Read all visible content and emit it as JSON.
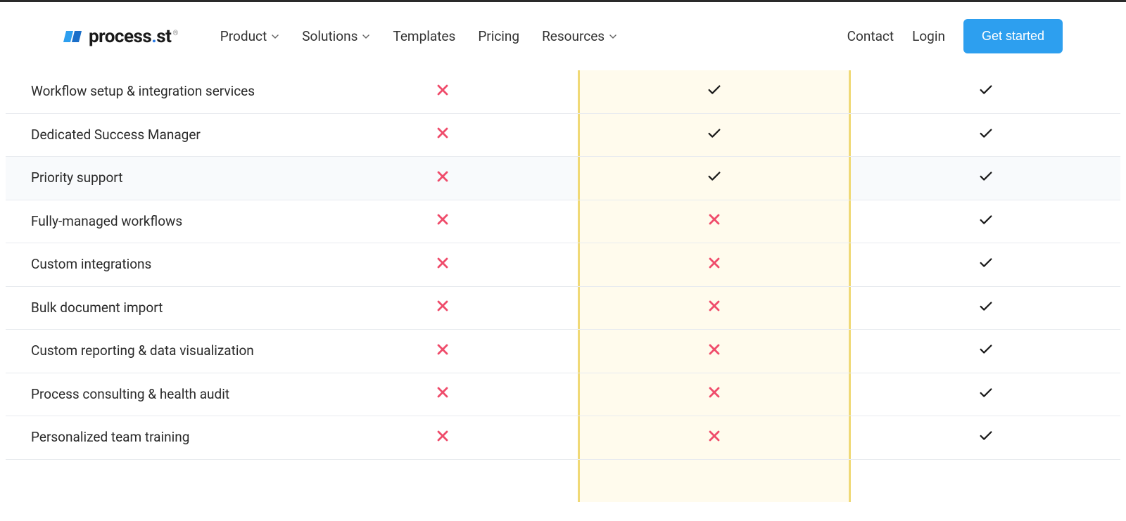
{
  "logo": {
    "text_prefix": "process",
    "text_dot": ".",
    "text_suffix": "st"
  },
  "nav": {
    "product": "Product",
    "solutions": "Solutions",
    "templates": "Templates",
    "pricing": "Pricing",
    "resources": "Resources"
  },
  "header_right": {
    "contact": "Contact",
    "login": "Login",
    "cta": "Get started"
  },
  "features": [
    {
      "label": "Workflow setup & integration services",
      "col1": false,
      "col2": true,
      "col3": true,
      "alt": false
    },
    {
      "label": "Dedicated Success Manager",
      "col1": false,
      "col2": true,
      "col3": true,
      "alt": false
    },
    {
      "label": "Priority support",
      "col1": false,
      "col2": true,
      "col3": true,
      "alt": true
    },
    {
      "label": "Fully-managed workflows",
      "col1": false,
      "col2": false,
      "col3": true,
      "alt": false
    },
    {
      "label": "Custom integrations",
      "col1": false,
      "col2": false,
      "col3": true,
      "alt": false
    },
    {
      "label": "Bulk document import",
      "col1": false,
      "col2": false,
      "col3": true,
      "alt": false
    },
    {
      "label": "Custom reporting & data visualization",
      "col1": false,
      "col2": false,
      "col3": true,
      "alt": false
    },
    {
      "label": "Process consulting & health audit",
      "col1": false,
      "col2": false,
      "col3": true,
      "alt": false
    },
    {
      "label": "Personalized team training",
      "col1": false,
      "col2": false,
      "col3": true,
      "alt": false
    }
  ]
}
